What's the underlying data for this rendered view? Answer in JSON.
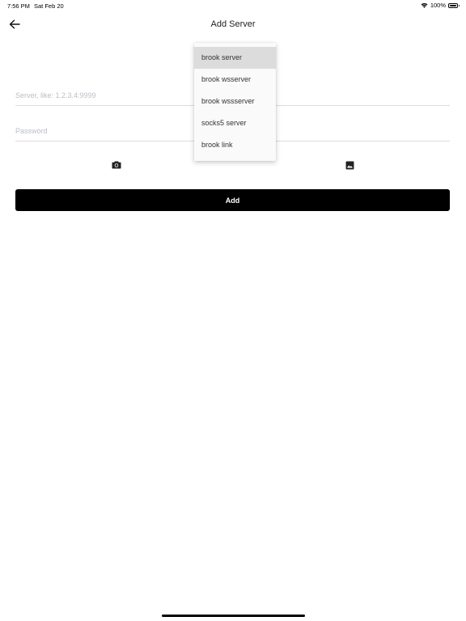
{
  "status_bar": {
    "time": "7:56 PM",
    "date": "Sat Feb 20",
    "battery_text": "100%",
    "battery_level": 1.0
  },
  "app_bar": {
    "title": "Add Server",
    "back_icon": "arrow-left-icon"
  },
  "form": {
    "server": {
      "placeholder": "Server, like: 1.2.3.4:9999",
      "value": ""
    },
    "password": {
      "placeholder": "Password",
      "value": ""
    },
    "camera_icon": "camera-icon",
    "image_icon": "image-icon",
    "add_label": "Add"
  },
  "dropdown": {
    "selected": "brook server",
    "options": [
      "brook server",
      "brook wsserver",
      "brook wssserver",
      "socks5 server",
      "brook link"
    ]
  },
  "colors": {
    "accent": "#000000",
    "placeholder": "#b9bec4",
    "menu_selected": "#dcdcdc"
  }
}
